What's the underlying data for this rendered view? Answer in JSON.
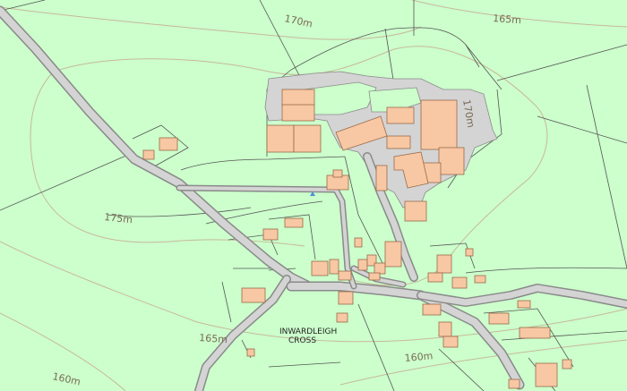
{
  "map": {
    "colors": {
      "land": "#ccffcc",
      "road": "#d4d4d4",
      "road_edge": "#8a8a8a",
      "building": "#f8c8a4",
      "building_edge": "#9a6a48",
      "contour": "#c8b89a",
      "boundary": "#555555",
      "water": "#4a90d9"
    },
    "contour_labels": {
      "c170_north": "170m",
      "c165_northeast": "165m",
      "c170_farm": "170m",
      "c175_west": "175m",
      "c165_south": "165m",
      "c160_southwest": "160m",
      "c160_south": "160m"
    },
    "place_name": {
      "line1": "INWARDLEIGH",
      "line2": "CROSS"
    }
  }
}
